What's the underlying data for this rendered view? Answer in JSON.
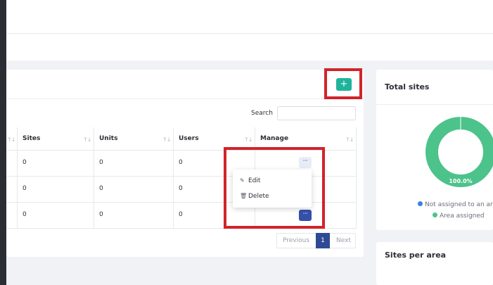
{
  "toolbar": {
    "add_label": "+"
  },
  "search": {
    "label": "Search",
    "value": ""
  },
  "table": {
    "columns": [
      "Sites",
      "Units",
      "Users",
      "Manage"
    ],
    "sort_glyph": "↑↓",
    "rows": [
      {
        "sites": "0",
        "units": "0",
        "users": "0"
      },
      {
        "sites": "0",
        "units": "0",
        "users": "0"
      },
      {
        "sites": "0",
        "units": "0",
        "users": "0"
      }
    ],
    "manage_button_label": "···"
  },
  "dropdown": {
    "items": [
      {
        "label": "Edit",
        "icon": "pencil-icon"
      },
      {
        "label": "Delete",
        "icon": "trash-icon"
      }
    ]
  },
  "pagination": {
    "previous": "Previous",
    "current_page": "1",
    "next": "Next"
  },
  "total_sites": {
    "title": "Total sites",
    "donut_label": "100.0%",
    "legend": [
      {
        "label": "Not assigned to an ar",
        "color": "#3b82d6"
      },
      {
        "label": "Area assigned",
        "color": "#4cc38a"
      }
    ]
  },
  "sites_per_area": {
    "title": "Sites per area"
  },
  "colors": {
    "accent_green": "#1fb39c",
    "primary_blue": "#2f4a94",
    "highlight_red": "#d2232a"
  }
}
